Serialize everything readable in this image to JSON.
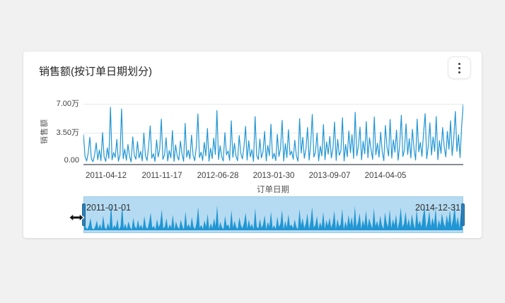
{
  "page": {
    "background": "#f1f1f1",
    "card_background": "#ffffff"
  },
  "card": {
    "title": "销售额(按订单日期划分)",
    "menu_icon": "kebab-vertical-icon"
  },
  "chart_data": {
    "type": "line",
    "title": "销售额(按订单日期划分)",
    "xlabel": "订单日期",
    "ylabel": "销售额",
    "x_range": [
      "2011-01-01",
      "2014-12-31"
    ],
    "xticks": [
      "2011-04-12",
      "2011-11-17",
      "2012-06-28",
      "2013-01-30",
      "2013-09-07",
      "2014-04-05"
    ],
    "yticks": [
      "7.00万",
      "3.50万",
      "0.00"
    ],
    "ylim": [
      0,
      70000
    ],
    "grid": true,
    "legend": "none",
    "series_name": "销售额",
    "series_color": "#2196d3",
    "values_note": "daily sales sampled/estimated from pixels, yuan",
    "values": [
      34000,
      8000,
      2500,
      12000,
      30500,
      5200,
      1800,
      9500,
      24000,
      4100,
      15500,
      2900,
      36000,
      7400,
      2100,
      18000,
      5600,
      66000,
      3800,
      12500,
      6700,
      28000,
      2300,
      9800,
      64000,
      5100,
      16500,
      3400,
      22000,
      7800,
      1500,
      31000,
      9200,
      4600,
      25500,
      6100,
      13800,
      2700,
      35500,
      8900,
      3200,
      19500,
      44000,
      5800,
      11200,
      2100,
      27500,
      7300,
      16200,
      52000,
      4400,
      9700,
      30000,
      2600,
      14800,
      6300,
      38500,
      1900,
      21500,
      8200,
      3700,
      26000,
      10800,
      2200,
      47000,
      7100,
      15300,
      4900,
      33000,
      9400,
      2800,
      18700,
      58000,
      6600,
      12900,
      3100,
      24500,
      8600,
      41000,
      2400,
      17600,
      5400,
      29500,
      10300,
      62000,
      4200,
      20500,
      7700,
      2600,
      36000,
      9900,
      14400,
      3300,
      50000,
      6900,
      23500,
      8100,
      2900,
      32500,
      12200,
      5000,
      19000,
      43500,
      3600,
      26500,
      7500,
      15900,
      2200,
      55000,
      9100,
      4300,
      28500,
      6200,
      13400,
      37500,
      2700,
      21000,
      8800,
      46000,
      5300,
      11700,
      3000,
      34000,
      7900,
      17200,
      50500,
      2500,
      23000,
      6500,
      39500,
      9600,
      14100,
      4700,
      27000,
      8300,
      2300,
      52500,
      11900,
      30500,
      5700,
      16800,
      42000,
      3500,
      22500,
      57500,
      7200,
      13100,
      35500,
      2800,
      20000,
      8500,
      45500,
      4000,
      25000,
      10600,
      31500,
      6000,
      17900,
      48500,
      3200,
      28000,
      9300,
      14700,
      53500,
      2600,
      22000,
      7600,
      38000,
      12400,
      33500,
      5500,
      60000,
      8700,
      19800,
      42500,
      3900,
      26000,
      11000,
      49000,
      6400,
      30000,
      15500,
      4500,
      54500,
      9800,
      23500,
      7000,
      36500,
      13700,
      2900,
      44500,
      18300,
      8400,
      51500,
      5900,
      27500,
      12800,
      39000,
      3400,
      21500,
      56500,
      7800,
      16100,
      46500,
      10200,
      29000,
      6100,
      40000,
      17000,
      3700,
      52000,
      13300,
      24500,
      8000,
      35000,
      58500,
      5200,
      20500,
      47500,
      9500,
      31000,
      14000,
      55000,
      4100,
      26500,
      11500,
      42000,
      19500,
      7300,
      37500,
      16400,
      50000,
      9000,
      28500,
      61000,
      13900,
      33500,
      6600,
      45000,
      69500
    ],
    "datazoom": {
      "start_label": "2011-01-01",
      "end_label": "2014-12-31",
      "window": [
        0,
        100
      ],
      "bg": "#b5dbf2",
      "fill": "#2196d3",
      "handle_color": "#2e7fb6"
    }
  }
}
